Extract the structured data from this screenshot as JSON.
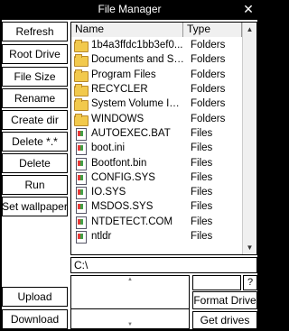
{
  "window": {
    "title": "File Manager"
  },
  "buttons": {
    "refresh": "Refresh",
    "root_drive": "Root Drive",
    "file_size": "File Size",
    "rename": "Rename",
    "create_dir": "Create dir",
    "delete_all": "Delete *.*",
    "delete": "Delete",
    "run": "Run",
    "set_wallpaper": "Set wallpaper",
    "upload": "Upload",
    "download": "Download",
    "format_drive": "Format Drive",
    "get_drives": "Get drives",
    "help": "?"
  },
  "filelist": {
    "columns": [
      "Name",
      "Type"
    ],
    "rows": [
      {
        "name": "1b4a3ffdc1bb3ef0...",
        "type": "Folders",
        "icon": "folder-icon"
      },
      {
        "name": "Documents and Se...",
        "type": "Folders",
        "icon": "folder-icon"
      },
      {
        "name": "Program Files",
        "type": "Folders",
        "icon": "folder-icon"
      },
      {
        "name": "RECYCLER",
        "type": "Folders",
        "icon": "folder-icon"
      },
      {
        "name": "System Volume Inf...",
        "type": "Folders",
        "icon": "folder-icon"
      },
      {
        "name": "WINDOWS",
        "type": "Folders",
        "icon": "folder-icon"
      },
      {
        "name": "AUTOEXEC.BAT",
        "type": "Files",
        "icon": "file-icon"
      },
      {
        "name": "boot.ini",
        "type": "Files",
        "icon": "file-icon"
      },
      {
        "name": "Bootfont.bin",
        "type": "Files",
        "icon": "file-icon"
      },
      {
        "name": "CONFIG.SYS",
        "type": "Files",
        "icon": "file-icon"
      },
      {
        "name": "IO.SYS",
        "type": "Files",
        "icon": "file-icon"
      },
      {
        "name": "MSDOS.SYS",
        "type": "Files",
        "icon": "file-icon"
      },
      {
        "name": "NTDETECT.COM",
        "type": "Files",
        "icon": "file-icon"
      },
      {
        "name": "ntldr",
        "type": "Files",
        "icon": "file-icon"
      }
    ]
  },
  "path": {
    "value": "C:\\"
  }
}
